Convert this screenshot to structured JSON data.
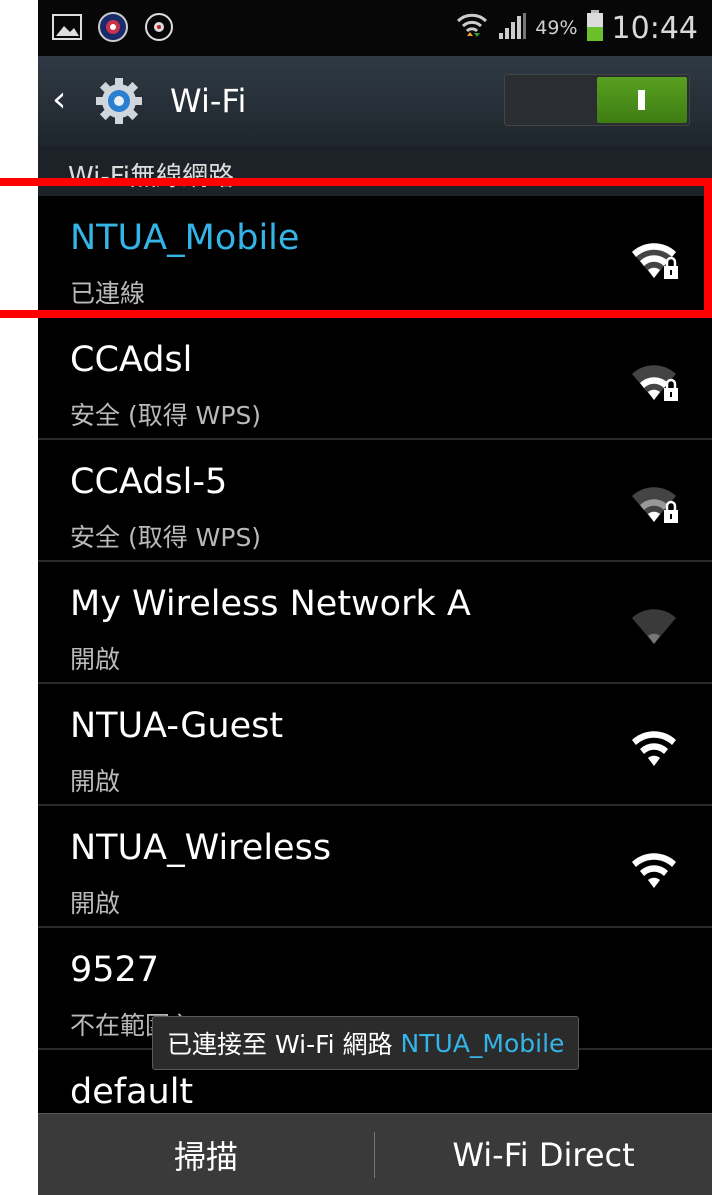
{
  "status_bar": {
    "battery_percent": "49%",
    "time": "10:44",
    "icons": [
      "gallery-icon",
      "app-badge-icon",
      "sound-icon",
      "wifi-status-icon",
      "signal-icon",
      "battery-icon"
    ]
  },
  "action_bar": {
    "title": "Wi-Fi",
    "toggle_label": "I",
    "wifi_enabled": true
  },
  "section": {
    "label": "Wi-Fi無線網路"
  },
  "networks": [
    {
      "ssid": "NTUA_Mobile",
      "status": "已連線",
      "secured": true,
      "connected": true,
      "strength": 3
    },
    {
      "ssid": "CCAdsl",
      "status": "安全 (取得 WPS)",
      "secured": true,
      "connected": false,
      "strength": 3
    },
    {
      "ssid": "CCAdsl-5",
      "status": "安全 (取得 WPS)",
      "secured": true,
      "connected": false,
      "strength": 2
    },
    {
      "ssid": "My Wireless Network A",
      "status": "開啟",
      "secured": false,
      "connected": false,
      "strength": 1
    },
    {
      "ssid": "NTUA-Guest",
      "status": "開啟",
      "secured": false,
      "connected": false,
      "strength": 4
    },
    {
      "ssid": "NTUA_Wireless",
      "status": "開啟",
      "secured": false,
      "connected": false,
      "strength": 4
    },
    {
      "ssid": "9527",
      "status": "不在範圍內",
      "secured": false,
      "connected": false,
      "strength": 0
    },
    {
      "ssid": "default",
      "status": "",
      "secured": false,
      "connected": false,
      "strength": 0
    }
  ],
  "toast": {
    "prefix": "已連接至 Wi-Fi 網路",
    "network": "NTUA_Mobile"
  },
  "bottom_bar": {
    "scan_label": "掃描",
    "direct_label": "Wi-Fi Direct"
  },
  "colors": {
    "accent": "#35b4e8",
    "toggle_on": "#4a8f18",
    "highlight": "#ff0000"
  }
}
